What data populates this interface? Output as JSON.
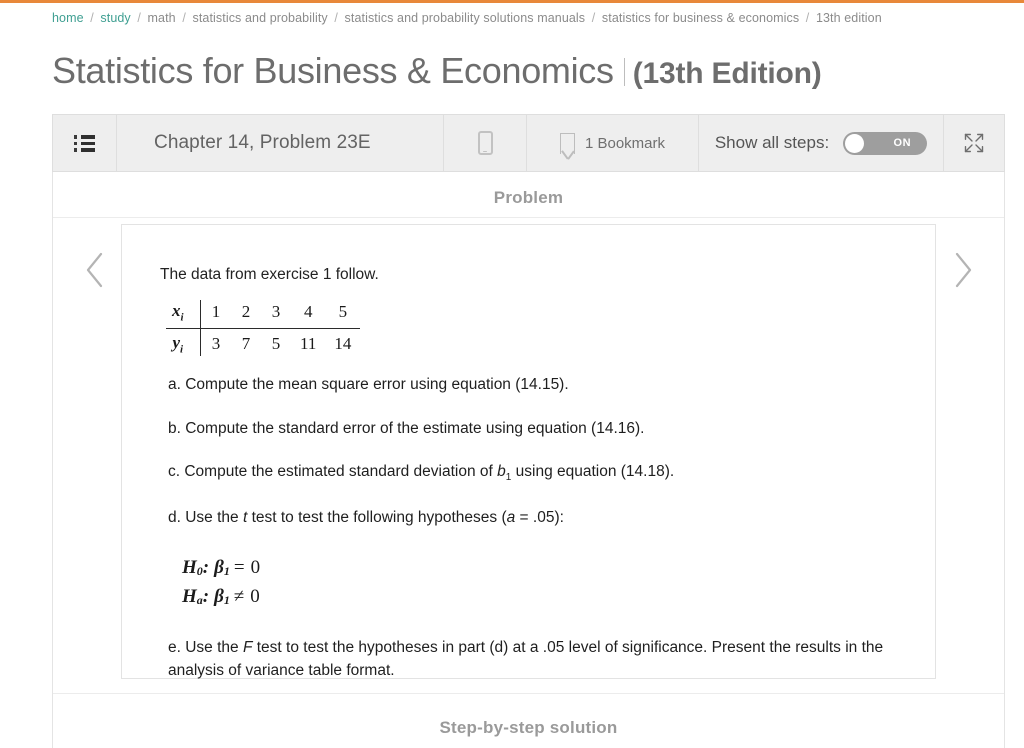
{
  "theme": {
    "accent_orange": "#e8883a",
    "link_teal": "#3f9f92",
    "title_gray": "#6d6d6d",
    "toolbar_bg": "#eeeeee",
    "toggle_on": "#9e9e9e"
  },
  "breadcrumb": {
    "separator": "/",
    "items": [
      {
        "label": "home",
        "is_link": true
      },
      {
        "label": "study",
        "is_link": true
      },
      {
        "label": "math",
        "is_link": false
      },
      {
        "label": "statistics and probability",
        "is_link": false
      },
      {
        "label": "statistics and probability solutions manuals",
        "is_link": false
      },
      {
        "label": "statistics for business & economics",
        "is_link": false
      },
      {
        "label": "13th edition",
        "is_link": false
      }
    ]
  },
  "title": {
    "main": "Statistics for Business & Economics",
    "edition": "(13th Edition)"
  },
  "toolbar": {
    "menu_icon": "list-icon",
    "chapter_label": "Chapter 14, Problem 23E",
    "device_icon": "mobile-device-icon",
    "bookmark_icon": "bookmark-icon",
    "bookmark_label": "1 Bookmark",
    "show_all_steps_label": "Show all steps:",
    "toggle_state": "ON",
    "expand_icon": "expand-arrows-icon"
  },
  "nav": {
    "prev_icon": "chevron-left-icon",
    "next_icon": "chevron-right-icon"
  },
  "sections": {
    "problem_heading": "Problem",
    "solution_heading": "Step-by-step solution"
  },
  "problem": {
    "intro": "The data from exercise 1 follow.",
    "data_table": {
      "row_x_label": "x",
      "row_x_sub": "i",
      "row_y_label": "y",
      "row_y_sub": "i",
      "x_values": [
        "1",
        "2",
        "3",
        "4",
        "5"
      ],
      "y_values": [
        "3",
        "7",
        "5",
        "11",
        "14"
      ]
    },
    "parts": [
      {
        "text_before": "a. Compute the mean square error using equation (14.15)."
      },
      {
        "text_before": "b. Compute the standard error of the estimate using equation (14.16)."
      },
      {
        "text_before": "c. Compute the estimated standard deviation of ",
        "italic": "b",
        "sub": "1",
        "text_after": " using equation (14.18)."
      },
      {
        "text_before": "d. Use the ",
        "italic": "t",
        "text_after": " test to test the following hypotheses (",
        "italic2": "a",
        "text_after2": " = .05):"
      }
    ],
    "part_a": "a. Compute the mean square error using equation (14.15).",
    "part_b": "b. Compute the standard error of the estimate using equation (14.16).",
    "part_c_pre": "c. Compute the estimated standard deviation of ",
    "part_c_var": "b",
    "part_c_sub": "1",
    "part_c_post": " using equation (14.18).",
    "part_d_pre": "d. Use the ",
    "part_d_var": "t",
    "part_d_mid": " test to test the following hypotheses (",
    "part_d_alpha": "a",
    "part_d_post": " = .05):",
    "hypotheses": [
      {
        "name": "H",
        "sub": "0",
        "colon": ":",
        "param": "β",
        "param_sub": "1",
        "operator": "=",
        "value": "0"
      },
      {
        "name": "H",
        "sub": "a",
        "colon": ":",
        "param": "β",
        "param_sub": "1",
        "operator": "≠",
        "value": "0"
      }
    ],
    "part_e_pre": "e. Use the ",
    "part_e_var": "F",
    "part_e_post": " test to test the hypotheses in part (d) at a .05 level of significance. Present the results in the analysis of variance table format."
  }
}
